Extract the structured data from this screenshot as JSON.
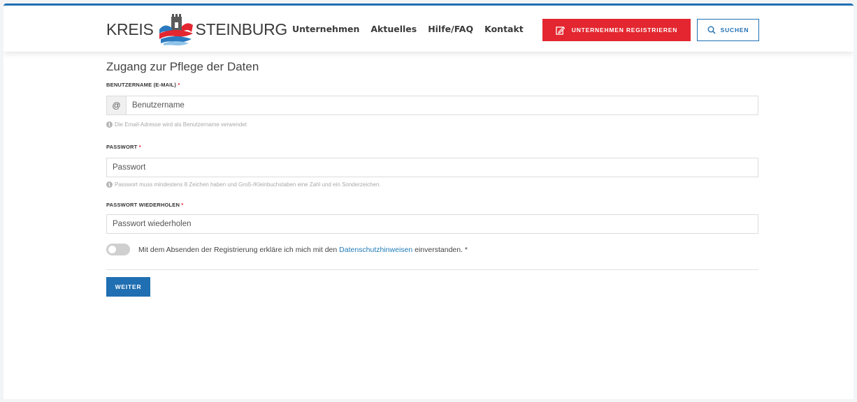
{
  "header": {
    "logo": {
      "word_left": "KREIS",
      "word_right": "STEINBURG"
    },
    "nav": [
      "Unternehmen",
      "Aktuelles",
      "Hilfe/FAQ",
      "Kontakt"
    ],
    "register_button": {
      "label": "UNTERNEHMEN REGISTRIEREN",
      "icon": "edit-icon",
      "color": "#e3262f"
    },
    "search_button": {
      "label": "SUCHEN",
      "icon": "search-icon",
      "color": "#1f6fb2"
    }
  },
  "form": {
    "title": "Zugang zur Pflege der Daten",
    "username": {
      "label": "BENUTZERNAME (E-MAIL)",
      "required_mark": "*",
      "addon": "@",
      "placeholder": "Benutzername",
      "hint": "Die Email-Adresse wird als Benutzername verwendet"
    },
    "password": {
      "label": "PASSWORT",
      "required_mark": "*",
      "placeholder": "Passwort",
      "hint": "Passwort muss mindestens 8 Zeichen haben und Groß-/Kleinbuchstaben eine Zahl und ein Sonderzeichen."
    },
    "password_repeat": {
      "label": "PASSWORT WIEDERHOLEN",
      "required_mark": "*",
      "placeholder": "Passwort wiederholen"
    },
    "consent": {
      "before": "Mit dem Absenden der Registrierung erkläre ich mich mit den ",
      "link": "Datenschutzhinweisen",
      "after": " einverstanden. *",
      "checked": false
    },
    "submit_label": "WEITER"
  }
}
